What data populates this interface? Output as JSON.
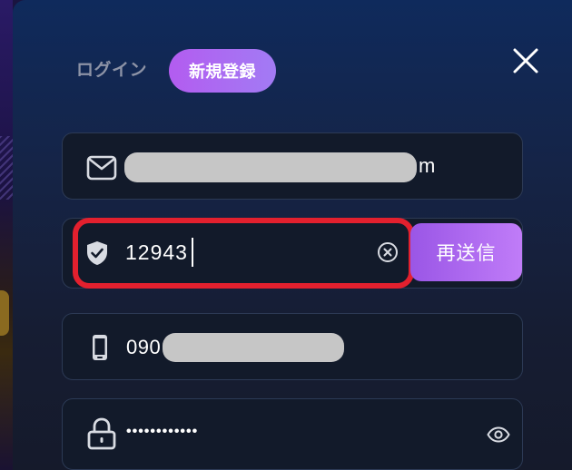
{
  "tabs": {
    "login_label": "ログイン",
    "register_label": "新規登録",
    "active": "新規登録"
  },
  "email": {
    "value_suffix": "m",
    "redacted": true
  },
  "verification_code": {
    "value": "12943",
    "resend_label": "再送信"
  },
  "phone": {
    "value_prefix": "090",
    "redacted": true
  },
  "password": {
    "masked_value": "••••••••••••"
  },
  "icons": {
    "close": "close-icon",
    "email": "mail-icon",
    "code": "shield-check-icon",
    "clear": "clear-circle-icon",
    "phone": "smartphone-icon",
    "password": "lock-icon",
    "visibility": "eye-icon"
  },
  "colors": {
    "accent_gradient_start": "#b35cf0",
    "accent_gradient_end": "#a27bf4",
    "highlight_border": "#e3202e",
    "field_border": "#2c3a55"
  }
}
